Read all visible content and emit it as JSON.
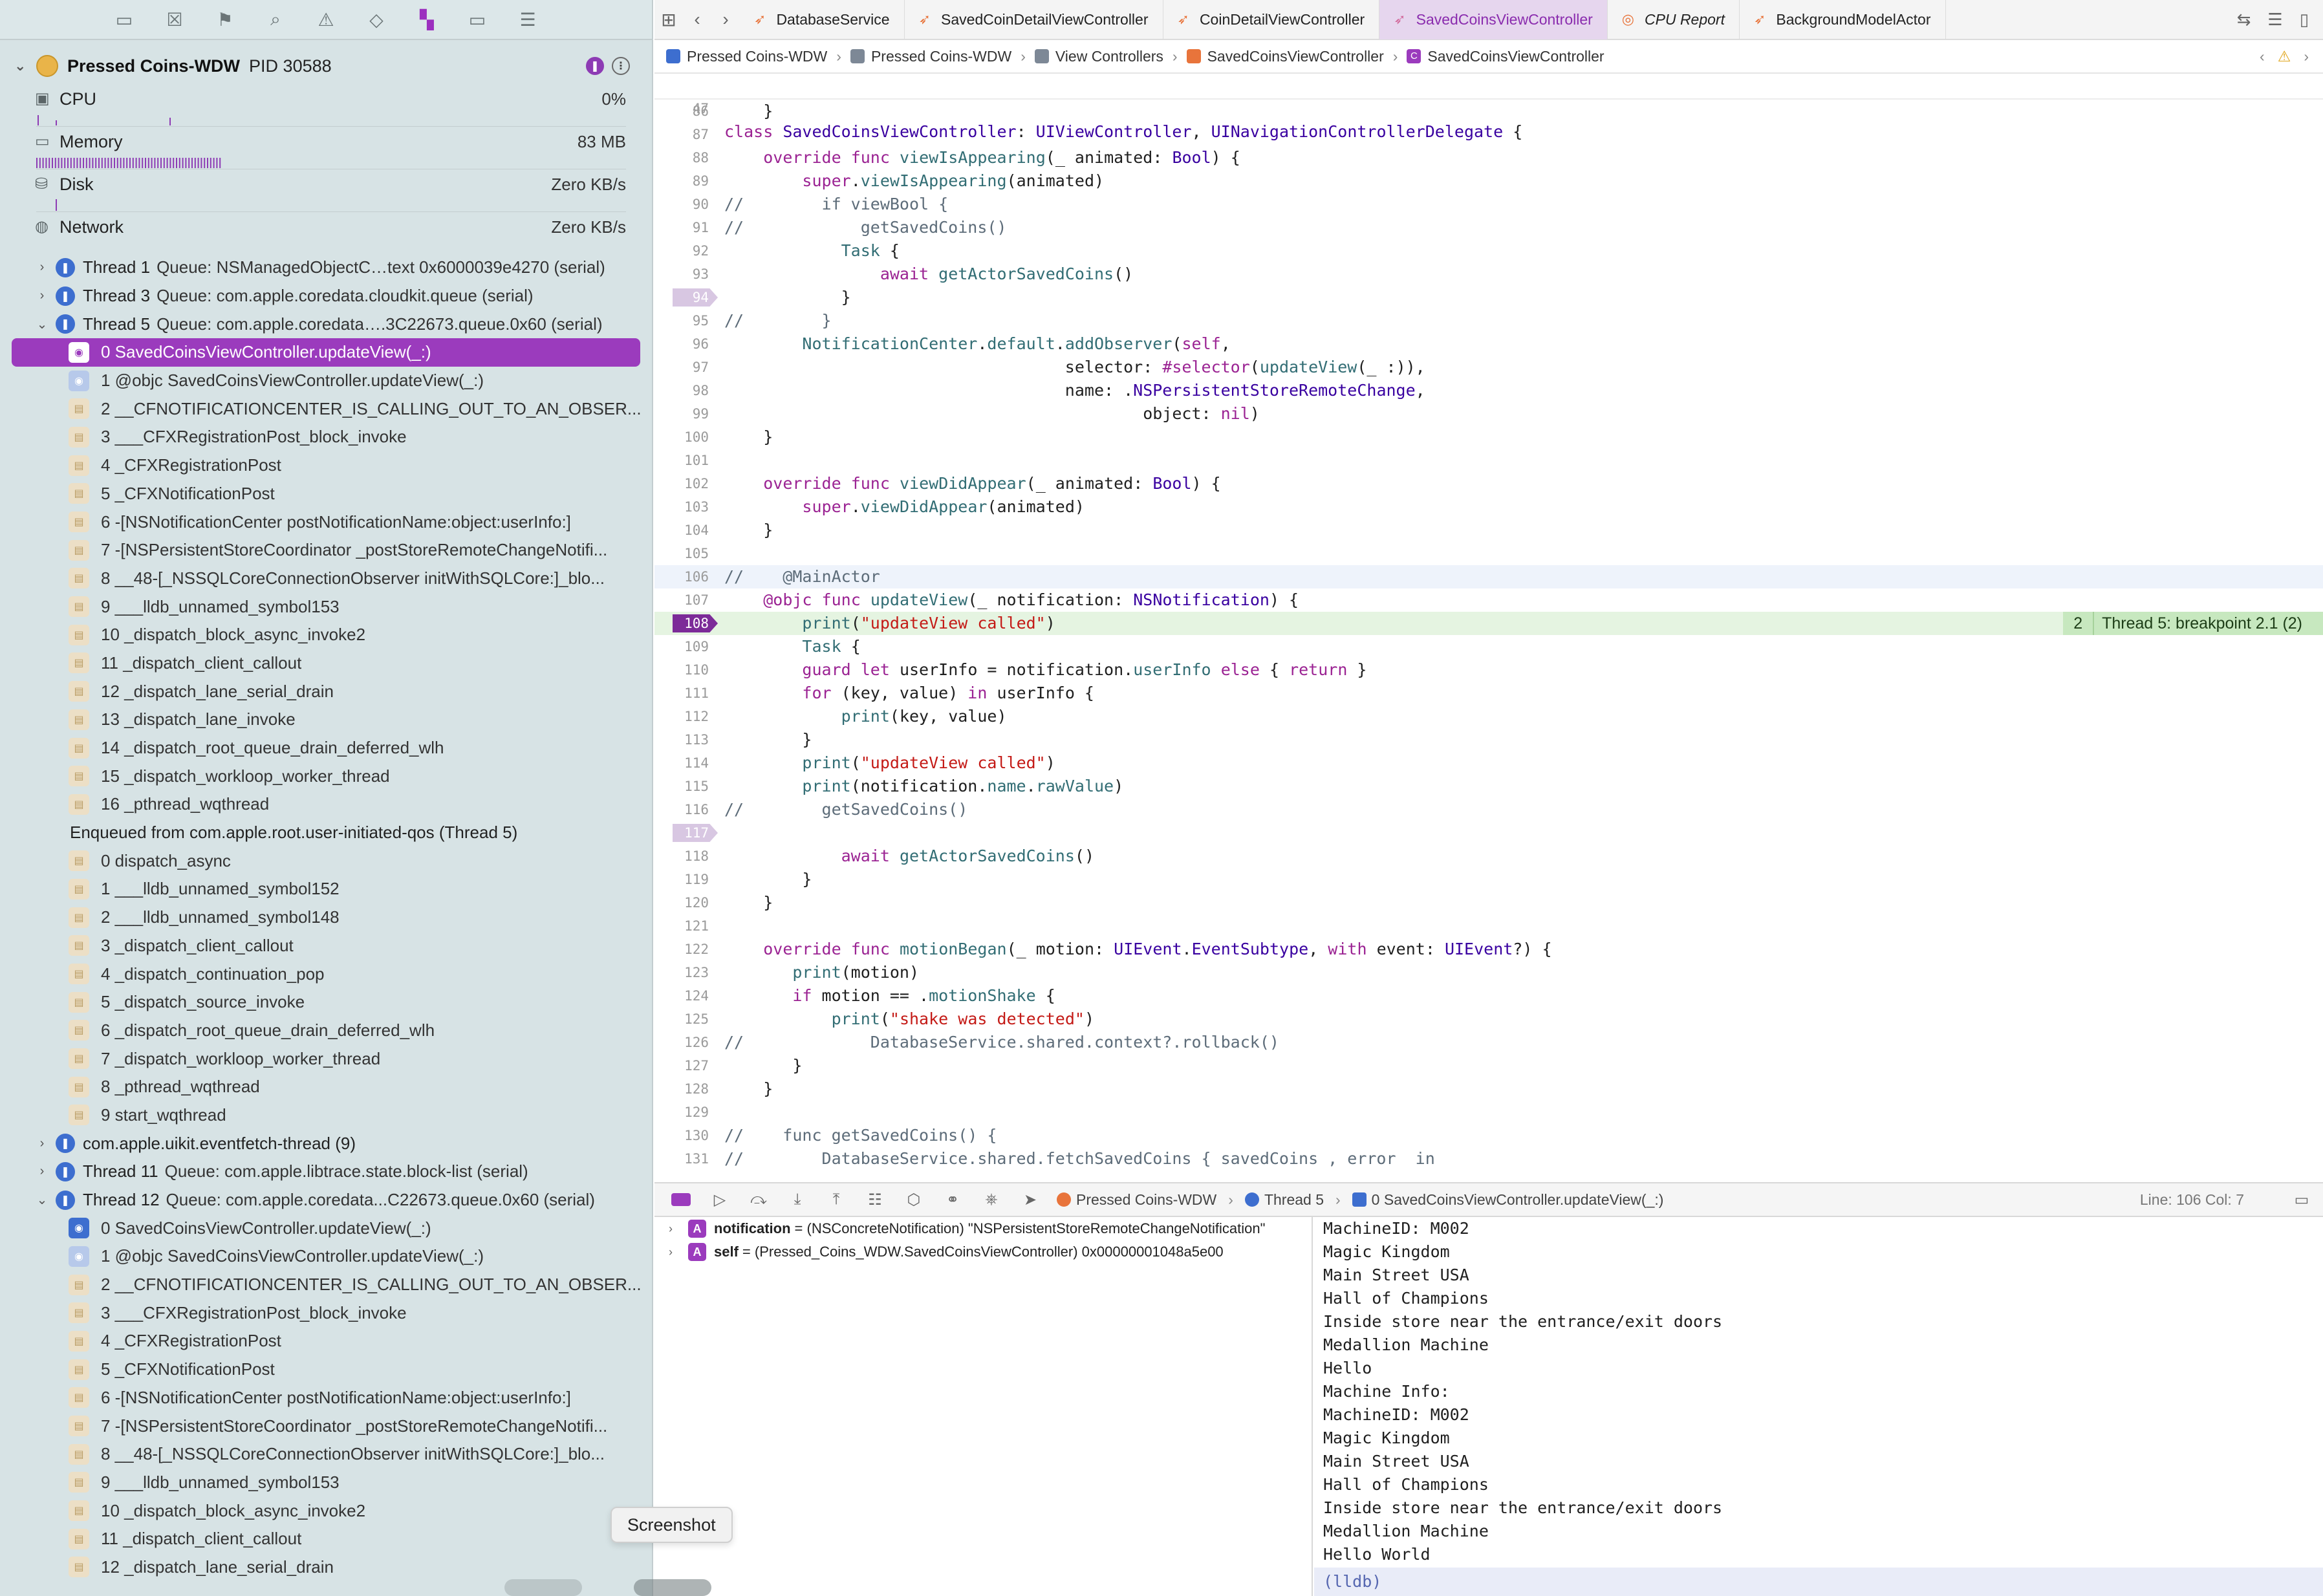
{
  "navigator": {
    "toolbar_icons": [
      "folder-icon",
      "source-control-icon",
      "bookmark-icon",
      "find-icon",
      "issues-icon",
      "tests-icon",
      "debug-navigator-icon",
      "breakpoints-icon",
      "report-icon"
    ],
    "process": {
      "name": "Pressed Coins-WDW",
      "pid": "PID 30588"
    },
    "gauges": [
      {
        "label": "CPU",
        "value": "0%"
      },
      {
        "label": "Memory",
        "value": "83 MB"
      },
      {
        "label": "Disk",
        "value": "Zero KB/s"
      },
      {
        "label": "Network",
        "value": "Zero KB/s"
      }
    ],
    "rows": [
      {
        "kind": "thread",
        "expanded": false,
        "name": "Thread 1",
        "sub": "Queue: NSManagedObjectC…text 0x6000039e4270 (serial)"
      },
      {
        "kind": "thread",
        "expanded": false,
        "name": "Thread 3",
        "sub": "Queue: com.apple.coredata.cloudkit.queue (serial)"
      },
      {
        "kind": "thread",
        "expanded": true,
        "name": "Thread 5",
        "sub": "Queue: com.apple.coredata….3C22673.queue.0x60 (serial)"
      },
      {
        "kind": "frame",
        "icon": "user",
        "selected": true,
        "text": "0 SavedCoinsViewController.updateView(_:)"
      },
      {
        "kind": "frame",
        "icon": "user-light",
        "text": "1 @objc SavedCoinsViewController.updateView(_:)"
      },
      {
        "kind": "frame",
        "icon": "sys",
        "text": "2 __CFNOTIFICATIONCENTER_IS_CALLING_OUT_TO_AN_OBSER..."
      },
      {
        "kind": "frame",
        "icon": "sys",
        "text": "3 ___CFXRegistrationPost_block_invoke"
      },
      {
        "kind": "frame",
        "icon": "sys",
        "text": "4 _CFXRegistrationPost"
      },
      {
        "kind": "frame",
        "icon": "sys",
        "text": "5 _CFXNotificationPost"
      },
      {
        "kind": "frame",
        "icon": "sys",
        "text": "6 -[NSNotificationCenter postNotificationName:object:userInfo:]"
      },
      {
        "kind": "frame",
        "icon": "sys",
        "text": "7 -[NSPersistentStoreCoordinator _postStoreRemoteChangeNotifi..."
      },
      {
        "kind": "frame",
        "icon": "sys",
        "text": "8 __48-[_NSSQLCoreConnectionObserver initWithSQLCore:]_blo..."
      },
      {
        "kind": "frame",
        "icon": "sys",
        "text": "9 ___lldb_unnamed_symbol153"
      },
      {
        "kind": "frame",
        "icon": "sys",
        "text": "10 _dispatch_block_async_invoke2"
      },
      {
        "kind": "frame",
        "icon": "sys",
        "text": "11 _dispatch_client_callout"
      },
      {
        "kind": "frame",
        "icon": "sys",
        "text": "12 _dispatch_lane_serial_drain"
      },
      {
        "kind": "frame",
        "icon": "sys",
        "text": "13 _dispatch_lane_invoke"
      },
      {
        "kind": "frame",
        "icon": "sys",
        "text": "14 _dispatch_root_queue_drain_deferred_wlh"
      },
      {
        "kind": "frame",
        "icon": "sys",
        "text": "15 _dispatch_workloop_worker_thread"
      },
      {
        "kind": "frame",
        "icon": "sys",
        "text": "16 _pthread_wqthread"
      },
      {
        "kind": "enqueued",
        "text": "Enqueued from com.apple.root.user-initiated-qos (Thread 5)"
      },
      {
        "kind": "frame",
        "icon": "sys",
        "text": "0 dispatch_async"
      },
      {
        "kind": "frame",
        "icon": "sys",
        "text": "1 ___lldb_unnamed_symbol152"
      },
      {
        "kind": "frame",
        "icon": "sys",
        "text": "2 ___lldb_unnamed_symbol148"
      },
      {
        "kind": "frame",
        "icon": "sys",
        "text": "3 _dispatch_client_callout"
      },
      {
        "kind": "frame",
        "icon": "sys",
        "text": "4 _dispatch_continuation_pop"
      },
      {
        "kind": "frame",
        "icon": "sys",
        "text": "5 _dispatch_source_invoke"
      },
      {
        "kind": "frame",
        "icon": "sys",
        "text": "6 _dispatch_root_queue_drain_deferred_wlh"
      },
      {
        "kind": "frame",
        "icon": "sys",
        "text": "7 _dispatch_workloop_worker_thread"
      },
      {
        "kind": "frame",
        "icon": "sys",
        "text": "8 _pthread_wqthread"
      },
      {
        "kind": "frame",
        "icon": "sys",
        "text": "9 start_wqthread"
      },
      {
        "kind": "thread",
        "expanded": false,
        "name": "com.apple.uikit.eventfetch-thread (9)",
        "sub": ""
      },
      {
        "kind": "thread",
        "expanded": false,
        "name": "Thread 11",
        "sub": "Queue: com.apple.libtrace.state.block-list (serial)"
      },
      {
        "kind": "thread",
        "expanded": true,
        "name": "Thread 12",
        "sub": "Queue: com.apple.coredata...C22673.queue.0x60 (serial)"
      },
      {
        "kind": "frame",
        "icon": "user",
        "text": "0 SavedCoinsViewController.updateView(_:)"
      },
      {
        "kind": "frame",
        "icon": "user-light",
        "text": "1 @objc SavedCoinsViewController.updateView(_:)"
      },
      {
        "kind": "frame",
        "icon": "sys",
        "text": "2 __CFNOTIFICATIONCENTER_IS_CALLING_OUT_TO_AN_OBSER..."
      },
      {
        "kind": "frame",
        "icon": "sys",
        "text": "3 ___CFXRegistrationPost_block_invoke"
      },
      {
        "kind": "frame",
        "icon": "sys",
        "text": "4 _CFXRegistrationPost"
      },
      {
        "kind": "frame",
        "icon": "sys",
        "text": "5 _CFXNotificationPost"
      },
      {
        "kind": "frame",
        "icon": "sys",
        "text": "6 -[NSNotificationCenter postNotificationName:object:userInfo:]"
      },
      {
        "kind": "frame",
        "icon": "sys",
        "text": "7 -[NSPersistentStoreCoordinator _postStoreRemoteChangeNotifi..."
      },
      {
        "kind": "frame",
        "icon": "sys",
        "text": "8 __48-[_NSSQLCoreConnectionObserver initWithSQLCore:]_blo..."
      },
      {
        "kind": "frame",
        "icon": "sys",
        "text": "9 ___lldb_unnamed_symbol153"
      },
      {
        "kind": "frame",
        "icon": "sys",
        "text": "10 _dispatch_block_async_invoke2"
      },
      {
        "kind": "frame",
        "icon": "sys",
        "text": "11 _dispatch_client_callout"
      },
      {
        "kind": "frame",
        "icon": "sys",
        "text": "12 _dispatch_lane_serial_drain"
      }
    ]
  },
  "tabs": [
    {
      "label": "DatabaseService",
      "active": false
    },
    {
      "label": "SavedCoinDetailViewController",
      "active": false
    },
    {
      "label": "CoinDetailViewController",
      "active": false
    },
    {
      "label": "SavedCoinsViewController",
      "active": true
    },
    {
      "label": "CPU Report",
      "active": false,
      "cpu": true
    },
    {
      "label": "BackgroundModelActor",
      "active": false
    }
  ],
  "jump_bar": [
    {
      "label": "Pressed Coins-WDW",
      "icon": "project"
    },
    {
      "label": "Pressed Coins-WDW",
      "icon": "folder"
    },
    {
      "label": "View Controllers",
      "icon": "folder"
    },
    {
      "label": "SavedCoinsViewController",
      "icon": "swift"
    },
    {
      "label": "SavedCoinsViewController",
      "icon": "cls"
    }
  ],
  "editor": {
    "sticky": {
      "num": "47",
      "html": "<span class='kw'>class</span> <span class='ty'>SavedCoinsViewController</span>: <span class='ty'>UIViewController</span>, <span class='ty'>UINavigationControllerDelegate</span> {"
    },
    "lines": [
      {
        "num": "86",
        "html": "    }"
      },
      {
        "num": "87",
        "html": ""
      },
      {
        "num": "88",
        "html": "    <span class='kw'>override</span> <span class='kw'>func</span> <span class='fn'>viewIsAppearing</span>(_ animated: <span class='ty'>Bool</span>) {"
      },
      {
        "num": "89",
        "html": "        <span class='kw'>super</span>.<span class='fn'>viewIsAppearing</span>(animated)"
      },
      {
        "num": "90",
        "html": "<span class='cm'>//        if viewBool {</span>"
      },
      {
        "num": "91",
        "html": "<span class='cm'>//            getSavedCoins()</span>"
      },
      {
        "num": "92",
        "html": "            <span class='fn'>Task</span> {"
      },
      {
        "num": "93",
        "html": "                <span class='kw'>await</span> <span class='fn'>getActorSavedCoins</span>()"
      },
      {
        "num": "94",
        "bp": "inactive",
        "html": "            }"
      },
      {
        "num": "95",
        "html": "<span class='cm'>//        }</span>"
      },
      {
        "num": "96",
        "html": "        <span class='fn'>NotificationCenter</span>.<span class='fn'>default</span>.<span class='fn'>addObserver</span>(<span class='kw'>self</span>,"
      },
      {
        "num": "97",
        "html": "                                   selector: <span class='kw'>#selector</span>(<span class='fn'>updateView</span>(_ :)),"
      },
      {
        "num": "98",
        "html": "                                   name: .<span class='ty'>NSPersistentStoreRemoteChange</span>,"
      },
      {
        "num": "99",
        "html": "                                           object: <span class='kw'>nil</span>)"
      },
      {
        "num": "100",
        "html": "    }"
      },
      {
        "num": "101",
        "html": ""
      },
      {
        "num": "102",
        "html": "    <span class='kw'>override</span> <span class='kw'>func</span> <span class='fn'>viewDidAppear</span>(_ animated: <span class='ty'>Bool</span>) {"
      },
      {
        "num": "103",
        "html": "        <span class='kw'>super</span>.<span class='fn'>viewDidAppear</span>(animated)"
      },
      {
        "num": "104",
        "html": "    }"
      },
      {
        "num": "105",
        "html": ""
      },
      {
        "num": "106",
        "cur": true,
        "html": "<span class='cm'>//    @MainActor</span>"
      },
      {
        "num": "107",
        "html": "    <span class='kw'>@objc</span> <span class='kw'>func</span> <span class='fn'>updateView</span>(_ notification: <span class='ty'>NSNotification</span>) {"
      },
      {
        "num": "108",
        "bp": "active",
        "hit": true,
        "html": "        <span class='fn'>print</span>(<span class='str'>\"updateView called\"</span>)",
        "ann_count": "2",
        "ann_msg": "Thread 5: breakpoint 2.1 (2)"
      },
      {
        "num": "109",
        "html": "        <span class='fn'>Task</span> {"
      },
      {
        "num": "110",
        "html": "        <span class='kw'>guard</span> <span class='kw'>let</span> userInfo = notification.<span class='fn'>userInfo</span> <span class='kw'>else</span> { <span class='kw'>return</span> }"
      },
      {
        "num": "111",
        "html": "        <span class='kw'>for</span> (key, value) <span class='kw'>in</span> userInfo {"
      },
      {
        "num": "112",
        "html": "            <span class='fn'>print</span>(key, value)"
      },
      {
        "num": "113",
        "html": "        }"
      },
      {
        "num": "114",
        "html": "        <span class='fn'>print</span>(<span class='str'>\"updateView called\"</span>)"
      },
      {
        "num": "115",
        "html": "        <span class='fn'>print</span>(notification.<span class='fn'>name</span>.<span class='fn'>rawValue</span>)"
      },
      {
        "num": "116",
        "html": "<span class='cm'>//        getSavedCoins()</span>"
      },
      {
        "num": "117",
        "bp": "inactive",
        "html": ""
      },
      {
        "num": "118",
        "html": "            <span class='kw'>await</span> <span class='fn'>getActorSavedCoins</span>()"
      },
      {
        "num": "119",
        "html": "        }"
      },
      {
        "num": "120",
        "html": "    }"
      },
      {
        "num": "121",
        "html": ""
      },
      {
        "num": "122",
        "html": "    <span class='kw'>override</span> <span class='kw'>func</span> <span class='fn'>motionBegan</span>(_ motion: <span class='ty'>UIEvent</span>.<span class='ty'>EventSubtype</span>, <span class='kw'>with</span> event: <span class='ty'>UIEvent</span>?) {"
      },
      {
        "num": "123",
        "html": "       <span class='fn'>print</span>(motion)"
      },
      {
        "num": "124",
        "html": "       <span class='kw'>if</span> motion == .<span class='fn'>motionShake</span> {"
      },
      {
        "num": "125",
        "html": "           <span class='fn'>print</span>(<span class='str'>\"shake was detected\"</span>)"
      },
      {
        "num": "126",
        "html": "<span class='cm'>//             DatabaseService.shared.context?.rollback()</span>"
      },
      {
        "num": "127",
        "html": "       }"
      },
      {
        "num": "128",
        "html": "    }"
      },
      {
        "num": "129",
        "html": ""
      },
      {
        "num": "130",
        "html": "<span class='cm'>//    func getSavedCoins() {</span>"
      },
      {
        "num": "131",
        "html": "<span class='cm'>//        DatabaseService.shared.fetchSavedCoins { savedCoins , error  in</span>"
      }
    ]
  },
  "debug_bar": {
    "crumbs": [
      {
        "label": "Pressed Coins-WDW",
        "icon": "app"
      },
      {
        "label": "Thread 5",
        "icon": "thread"
      },
      {
        "label": "0 SavedCoinsViewController.updateView(_:)",
        "icon": "usr"
      }
    ],
    "position": "Line: 106  Col: 7"
  },
  "variables": [
    {
      "name": "notification",
      "rest": "= (NSConcreteNotification) \"NSPersistentStoreRemoteChangeNotification\""
    },
    {
      "name": "self",
      "rest": "= (Pressed_Coins_WDW.SavedCoinsViewController) 0x00000001048a5e00"
    }
  ],
  "console": {
    "lines": [
      "MachineID: M002",
      "Magic Kingdom",
      "Main Street USA",
      "Hall of Champions",
      "Inside store near the entrance/exit doors",
      "Medallion Machine",
      "Hello",
      "Machine Info:",
      "MachineID: M002",
      "Magic Kingdom",
      "Main Street USA",
      "Hall of Champions",
      "Inside store near the entrance/exit doors",
      "Medallion Machine",
      "Hello World"
    ],
    "prompt": "(lldb)"
  },
  "tooltip": "Screenshot",
  "colors": {
    "accent": "#9b3bbd",
    "breakpoint_hit_bg": "#e5f4e1",
    "navigator_bg": "#d7e3e5"
  }
}
